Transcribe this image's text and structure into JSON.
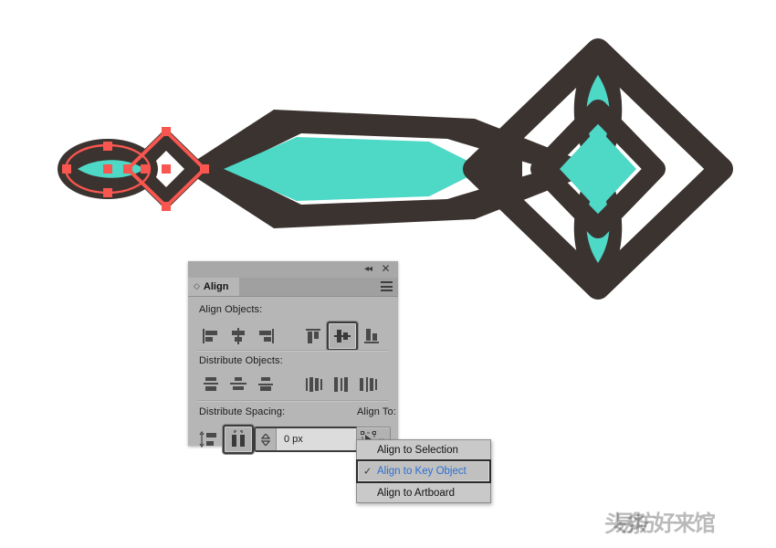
{
  "colors": {
    "artwork_dark": "#3b3330",
    "artwork_teal": "#4ed8c6",
    "selection_red": "#f9564f",
    "panel_bg": "#b6b6b6",
    "menu_highlight_text": "#2b6fd0",
    "canvas_bg": "#ffffff"
  },
  "panel": {
    "title": "Align",
    "tab_grip_icon": "double-chevron-grip-icon",
    "collapse_icon": "◂◂",
    "close_icon": "✕",
    "menu_icon": "panel-menu-icon",
    "sections": {
      "align_objects_label": "Align Objects:",
      "distribute_objects_label": "Distribute Objects:",
      "distribute_spacing_label": "Distribute Spacing:",
      "align_to_label": "Align To:"
    },
    "align_objects_buttons": [
      {
        "name": "horizontal-align-left",
        "selected": false
      },
      {
        "name": "horizontal-align-center",
        "selected": false
      },
      {
        "name": "horizontal-align-right",
        "selected": false
      },
      {
        "name": "vertical-align-top",
        "selected": false
      },
      {
        "name": "vertical-align-center",
        "selected": true
      },
      {
        "name": "vertical-align-bottom",
        "selected": false
      }
    ],
    "distribute_objects_buttons": [
      {
        "name": "vertical-distribute-top",
        "selected": false
      },
      {
        "name": "vertical-distribute-center",
        "selected": false
      },
      {
        "name": "vertical-distribute-bottom",
        "selected": false
      },
      {
        "name": "horizontal-distribute-left",
        "selected": false
      },
      {
        "name": "horizontal-distribute-center",
        "selected": false
      },
      {
        "name": "horizontal-distribute-right",
        "selected": false
      }
    ],
    "distribute_spacing_buttons": [
      {
        "name": "vertical-distribute-spacing",
        "selected": false
      },
      {
        "name": "horizontal-distribute-spacing",
        "selected": true
      }
    ],
    "spacing_value": "0 px",
    "spacing_placeholder": "0 px",
    "align_to_icon": "align-to-key-object-icon",
    "align_to_chevron": "⌄"
  },
  "dropdown": {
    "items": [
      {
        "label": "Align to Selection",
        "checked": false
      },
      {
        "label": "Align to Key Object",
        "checked": true
      },
      {
        "label": "Align to Artboard",
        "checked": false
      }
    ],
    "check_glyph": "✓"
  },
  "watermark": {
    "text_primary": "头条",
    "text_secondary": "易坊好来馆"
  }
}
